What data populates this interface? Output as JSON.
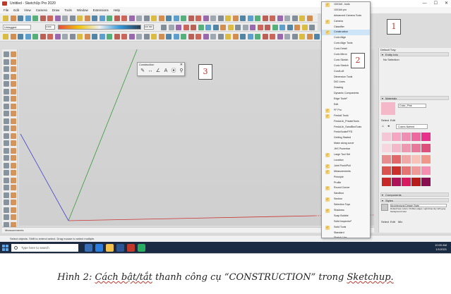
{
  "window": {
    "title": "Untitled - SketchUp Pro 2020",
    "controls": [
      "—",
      "☐",
      "✕"
    ]
  },
  "menubar": [
    "File",
    "Edit",
    "View",
    "Camera",
    "Draw",
    "Tools",
    "Window",
    "Extensions",
    "Help"
  ],
  "toolbar": {
    "layer_combo": "Untagged",
    "scale_min": "0.000",
    "scale_max": "100.000"
  },
  "viewport": {
    "measurements_label": "Measurements"
  },
  "status": {
    "hint": "Select objects. Shift to extend select. Drag mouse to select multiple."
  },
  "taskbar": {
    "search_placeholder": "Type here to search",
    "clock_time": "10:00 AM",
    "clock_date": "1/1/2021"
  },
  "toolbar_menu": {
    "items": [
      {
        "label": "1001bit - tools",
        "checked": true
      },
      {
        "label": "1001bit pro",
        "checked": false
      },
      {
        "label": "Advanced Camera Tools",
        "checked": false
      },
      {
        "label": "Camera",
        "checked": true
      },
      {
        "label": "Classifier",
        "checked": false
      },
      {
        "label": "Construction",
        "checked": true
      },
      {
        "label": "Curic Align",
        "checked": false
      },
      {
        "label": "Curic Align Tools",
        "checked": false
      },
      {
        "label": "Curic Detail",
        "checked": false
      },
      {
        "label": "Curic Mirror",
        "checked": false
      },
      {
        "label": "Curic Sketch",
        "checked": false
      },
      {
        "label": "Curic Stretch",
        "checked": false
      },
      {
        "label": "CurviLoft",
        "checked": false
      },
      {
        "label": "Dimension Tools",
        "checked": false
      },
      {
        "label": "DiO Lines",
        "checked": false
      },
      {
        "label": "Drawing",
        "checked": false
      },
      {
        "label": "Dynamic Components",
        "checked": false
      },
      {
        "label": "Edge Tools²",
        "checked": false
      },
      {
        "label": "Edit",
        "checked": false
      },
      {
        "label": "FF Pro",
        "checked": true
      },
      {
        "label": "Fredo6 Tools",
        "checked": true
      },
      {
        "label": "FredoLib_PrivateTools",
        "checked": false
      },
      {
        "label": "FredoLib_SandBoxTools",
        "checked": false
      },
      {
        "label": "FredoScale/FFD",
        "checked": false
      },
      {
        "label": "Getting Started",
        "checked": false
      },
      {
        "label": "Make along curve",
        "checked": false
      },
      {
        "label": "JHS Powerbar",
        "checked": false
      },
      {
        "label": "Large Tool Set",
        "checked": true
      },
      {
        "label": "Location",
        "checked": false
      },
      {
        "label": "Joint Push/Pull",
        "checked": true
      },
      {
        "label": "Measurements",
        "checked": true
      },
      {
        "label": "Principle",
        "checked": false
      },
      {
        "label": "Profile",
        "checked": false
      },
      {
        "label": "Round Corner",
        "checked": true
      },
      {
        "label": "Sandbox",
        "checked": false
      },
      {
        "label": "Section",
        "checked": true
      },
      {
        "label": "Selection Toys",
        "checked": false
      },
      {
        "label": "Shadows",
        "checked": true
      },
      {
        "label": "Soap Bubble",
        "checked": false
      },
      {
        "label": "Solid Inspector²",
        "checked": false
      },
      {
        "label": "Solid Tools",
        "checked": true
      },
      {
        "label": "Standard",
        "checked": false
      },
      {
        "label": "Sketch Ups",
        "checked": false
      }
    ]
  },
  "default_tray": {
    "title": "Default Tray",
    "entity_info_header": "Entity Info",
    "entity_info_text": "No Selection",
    "materials_header": "Materials",
    "material_name": "Color_Pink",
    "tab_select": "Select",
    "tab_edit": "Edit",
    "material_collection": "Colors-Named",
    "components_header": "Components",
    "styles_header": "Styles",
    "style_name": "Architectural Design Style",
    "style_desc": "Default face colors. Profiles edges. Light blue sky with gray background color.",
    "style_tabs": [
      "Select",
      "Edit",
      "Mix"
    ]
  },
  "construction_toolbar": {
    "title": "Construction",
    "close": "✕",
    "icons": [
      "✎",
      "↔",
      "∠",
      "A",
      "⦿",
      "⚲"
    ]
  },
  "callouts": [
    "1",
    "2",
    "3"
  ],
  "caption": {
    "prefix": "Hình 2: ",
    "underlined": "Cách bật/tắt",
    "middle": " thanh công cụ “CONSTRUCTION” trong ",
    "suffix": "Sketchup."
  }
}
